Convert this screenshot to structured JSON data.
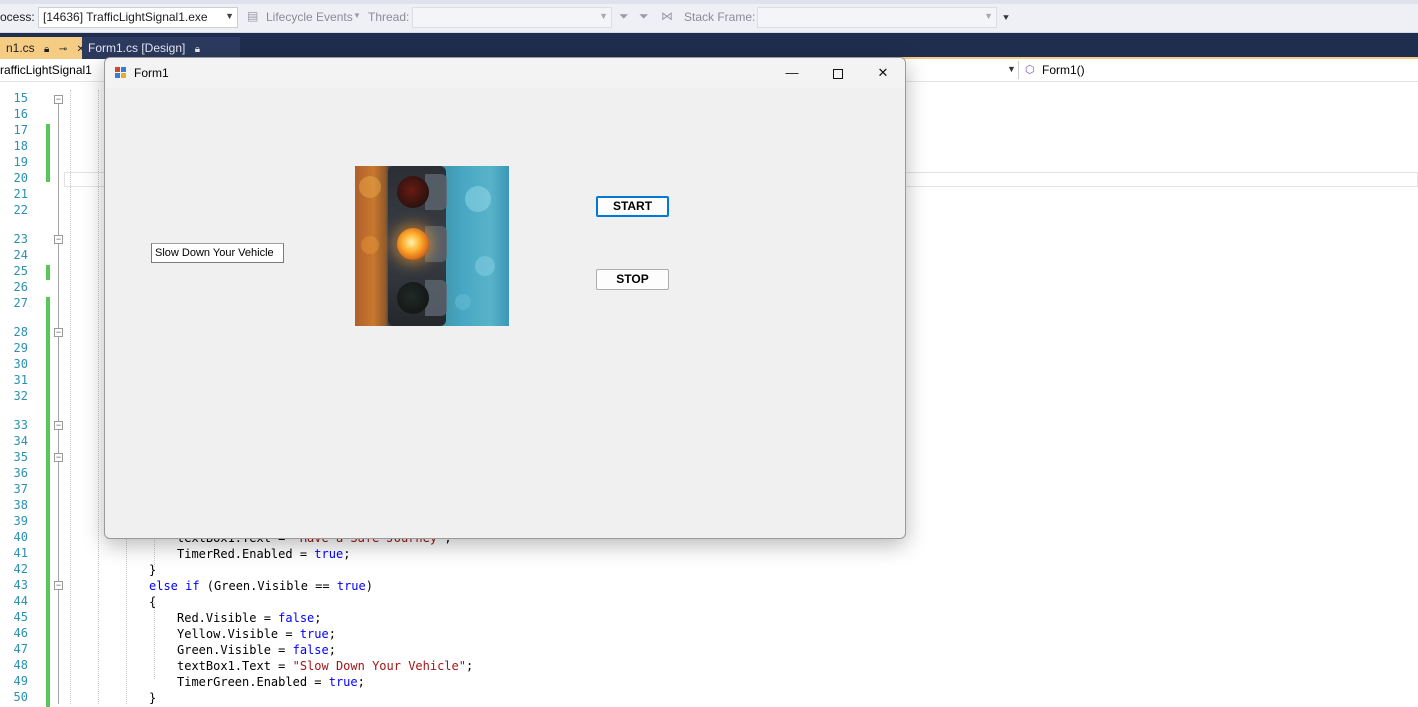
{
  "toolbar": {
    "process_label": "ocess:",
    "process_value": "[14636] TrafficLightSignal1.exe",
    "lifecycle_label": "Lifecycle Events",
    "thread_label": "Thread:",
    "thread_value": "",
    "stack_frame_label": "Stack Frame:",
    "stack_frame_value": ""
  },
  "tabs": [
    {
      "label": "n1.cs",
      "pin": "⊸",
      "close": "✕",
      "state": "active"
    },
    {
      "label": "Form1.cs [Design]",
      "pin": "",
      "close": "",
      "state": "inactive"
    }
  ],
  "navbar": {
    "project": "rafficLightSignal1",
    "member": "Form1()"
  },
  "editor": {
    "line_numbers": [
      "15",
      "16",
      "17",
      "18",
      "19",
      "20",
      "21",
      "22",
      "23",
      "24",
      "25",
      "26",
      "27",
      "28",
      "29",
      "30",
      "31",
      "32",
      "33",
      "34",
      "35",
      "36",
      "37",
      "38",
      "39",
      "40",
      "41",
      "42",
      "43",
      "44",
      "45",
      "46",
      "47",
      "48",
      "49",
      "50"
    ],
    "visible_code": [
      "textBox1.Text = \"Have a Safe Journey\";",
      "TimerRed.Enabled = true;",
      "}",
      "else if (Green.Visible == true)",
      "{",
      "Red.Visible = false;",
      "Yellow.Visible = true;",
      "Green.Visible = false;",
      "textBox1.Text = \"Slow Down Your Vehicle\";",
      "TimerGreen.Enabled = true;",
      "}"
    ]
  },
  "form": {
    "title": "Form1",
    "minimize": "—",
    "close": "✕",
    "textbox_value": "Slow Down Your Vehicle",
    "start_label": "START",
    "stop_label": "STOP",
    "image_alt": "traffic light with yellow lamp lit"
  },
  "colors": {
    "tab_active": "#f5cc84",
    "tab_bar": "#1f2d4f",
    "line_number": "#2b91af",
    "keyword": "#0000ff",
    "string": "#a31515",
    "change_bar": "#57c758",
    "default_button_border": "#0078d7"
  }
}
